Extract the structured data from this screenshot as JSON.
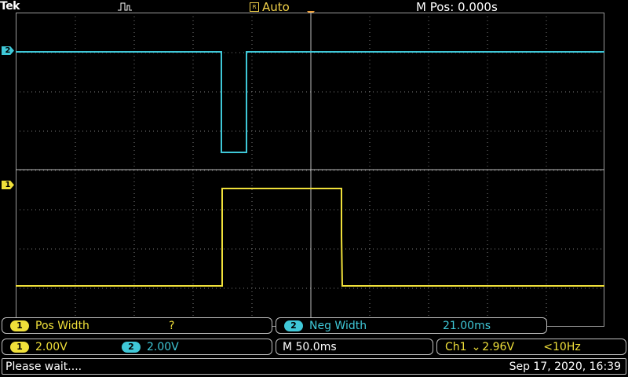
{
  "header": {
    "brand": "Tek",
    "acquisition_icon": "square-pulse-icon",
    "trigger_state": "Auto",
    "trigger_state_icon_text": "R",
    "horizontal_position": "M Pos: 0.000s"
  },
  "channels": {
    "ch1": {
      "marker": "1",
      "color": "#f0e03a"
    },
    "ch2": {
      "marker": "2",
      "color": "#3fc8d8"
    }
  },
  "measurements": [
    {
      "channel": "1",
      "label": "Pos Width",
      "value": "?",
      "color": "#f0e03a"
    },
    {
      "channel": "2",
      "label": "Neg Width",
      "value": "21.00ms",
      "color": "#3fc8d8"
    }
  ],
  "vertical": {
    "ch1_scale": "2.00V",
    "ch2_scale": "2.00V"
  },
  "timebase": "M 50.0ms",
  "trigger": {
    "source": "Ch1",
    "slope_symbol": "⌄",
    "level": "2.96V",
    "frequency": "<10Hz"
  },
  "status": {
    "message": "Please wait....",
    "datetime": "Sep 17, 2020, 16:39"
  },
  "colors": {
    "ch1": "#f0e03a",
    "ch2": "#3fc8d8",
    "grid": "#9a9a9a",
    "trigger_marker": "#f2a23a"
  }
}
